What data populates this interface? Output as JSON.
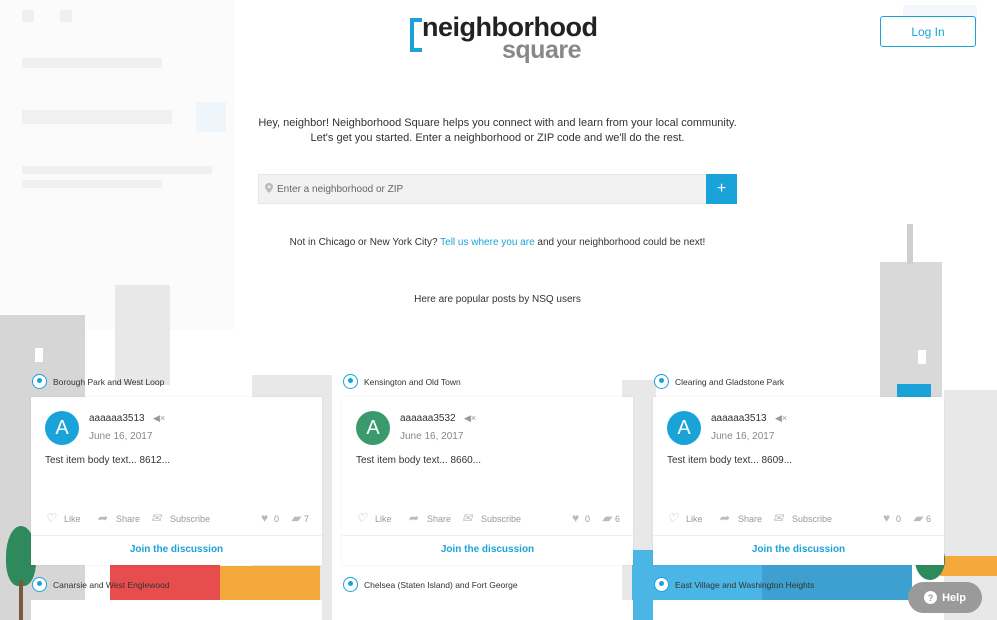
{
  "header": {
    "logo_word1": "neighborhood",
    "logo_word2": "square",
    "login_label": "Log In"
  },
  "intro": {
    "line1": "Hey, neighbor! Neighborhood Square helps you connect with and learn from your local community.",
    "line2": "Let's get you started. Enter a neighborhood or ZIP code and we'll do the rest."
  },
  "search": {
    "placeholder": "Enter a neighborhood or ZIP",
    "submit_icon": "plus-icon"
  },
  "not_chicago": {
    "prefix": "Not in Chicago or New York City?",
    "link": "Tell us where you are",
    "suffix": "and your neighborhood could be next!"
  },
  "popular_heading": "Here are popular posts by NSQ users",
  "posts": [
    {
      "location": "Borough Park and West Loop",
      "avatar_letter": "A",
      "avatar_color": "#1aa3d9",
      "username": "aaaaaa3513",
      "date": "June 16, 2017",
      "body": "Test item body text... 8612...",
      "like_label": "Like",
      "share_label": "Share",
      "subscribe_label": "Subscribe",
      "likes": "0",
      "comments": "7",
      "join_label": "Join the discussion"
    },
    {
      "location": "Kensington and Old Town",
      "avatar_letter": "A",
      "avatar_color": "#3a9a6b",
      "username": "aaaaaa3532",
      "date": "June 16, 2017",
      "body": "Test item body text... 8660...",
      "like_label": "Like",
      "share_label": "Share",
      "subscribe_label": "Subscribe",
      "likes": "0",
      "comments": "6",
      "join_label": "Join the discussion"
    },
    {
      "location": "Clearing and Gladstone Park",
      "avatar_letter": "A",
      "avatar_color": "#1aa3d9",
      "username": "aaaaaa3513",
      "date": "June 16, 2017",
      "body": "Test item body text... 8609...",
      "like_label": "Like",
      "share_label": "Share",
      "subscribe_label": "Subscribe",
      "likes": "0",
      "comments": "6",
      "join_label": "Join the discussion"
    }
  ],
  "next_locations": [
    "Canarsie and West Englewood",
    "Chelsea (Staten Island) and Fort George",
    "East Village and Washington Heights"
  ],
  "help_label": "Help",
  "colors": {
    "accent": "#1aa3d9",
    "avatar_green": "#3a9a6b"
  }
}
